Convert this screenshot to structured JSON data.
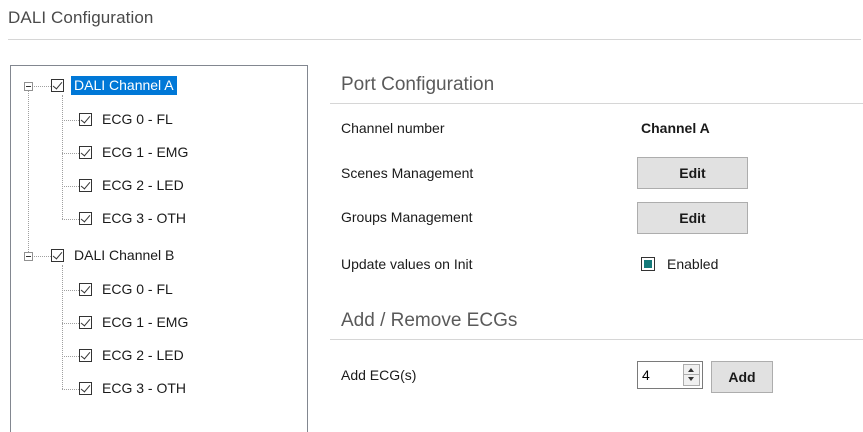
{
  "page": {
    "title": "DALI Configuration"
  },
  "tree": {
    "channels": [
      {
        "label": "DALI Channel A",
        "checked": true,
        "selected": true,
        "children": [
          {
            "label": "ECG 0 - FL",
            "checked": true
          },
          {
            "label": "ECG 1 - EMG",
            "checked": true
          },
          {
            "label": "ECG 2 - LED",
            "checked": true
          },
          {
            "label": "ECG 3 - OTH",
            "checked": true
          }
        ]
      },
      {
        "label": "DALI Channel B",
        "checked": true,
        "selected": false,
        "children": [
          {
            "label": "ECG 0 - FL",
            "checked": true
          },
          {
            "label": "ECG 1 - EMG",
            "checked": true
          },
          {
            "label": "ECG 2 - LED",
            "checked": true
          },
          {
            "label": "ECG 3 - OTH",
            "checked": true
          }
        ]
      }
    ]
  },
  "port_config": {
    "title": "Port Configuration",
    "channel_number_label": "Channel number",
    "channel_number_value": "Channel A",
    "scenes_label": "Scenes Management",
    "scenes_button": "Edit",
    "groups_label": "Groups Management",
    "groups_button": "Edit",
    "update_label": "Update values on Init",
    "update_enabled_label": "Enabled",
    "update_enabled": true
  },
  "add_remove": {
    "title": "Add / Remove ECGs",
    "add_label": "Add ECG(s)",
    "count_value": "4",
    "add_button": "Add"
  },
  "colors": {
    "selection": "#0078d7",
    "enabled_fill": "#157a7a"
  }
}
